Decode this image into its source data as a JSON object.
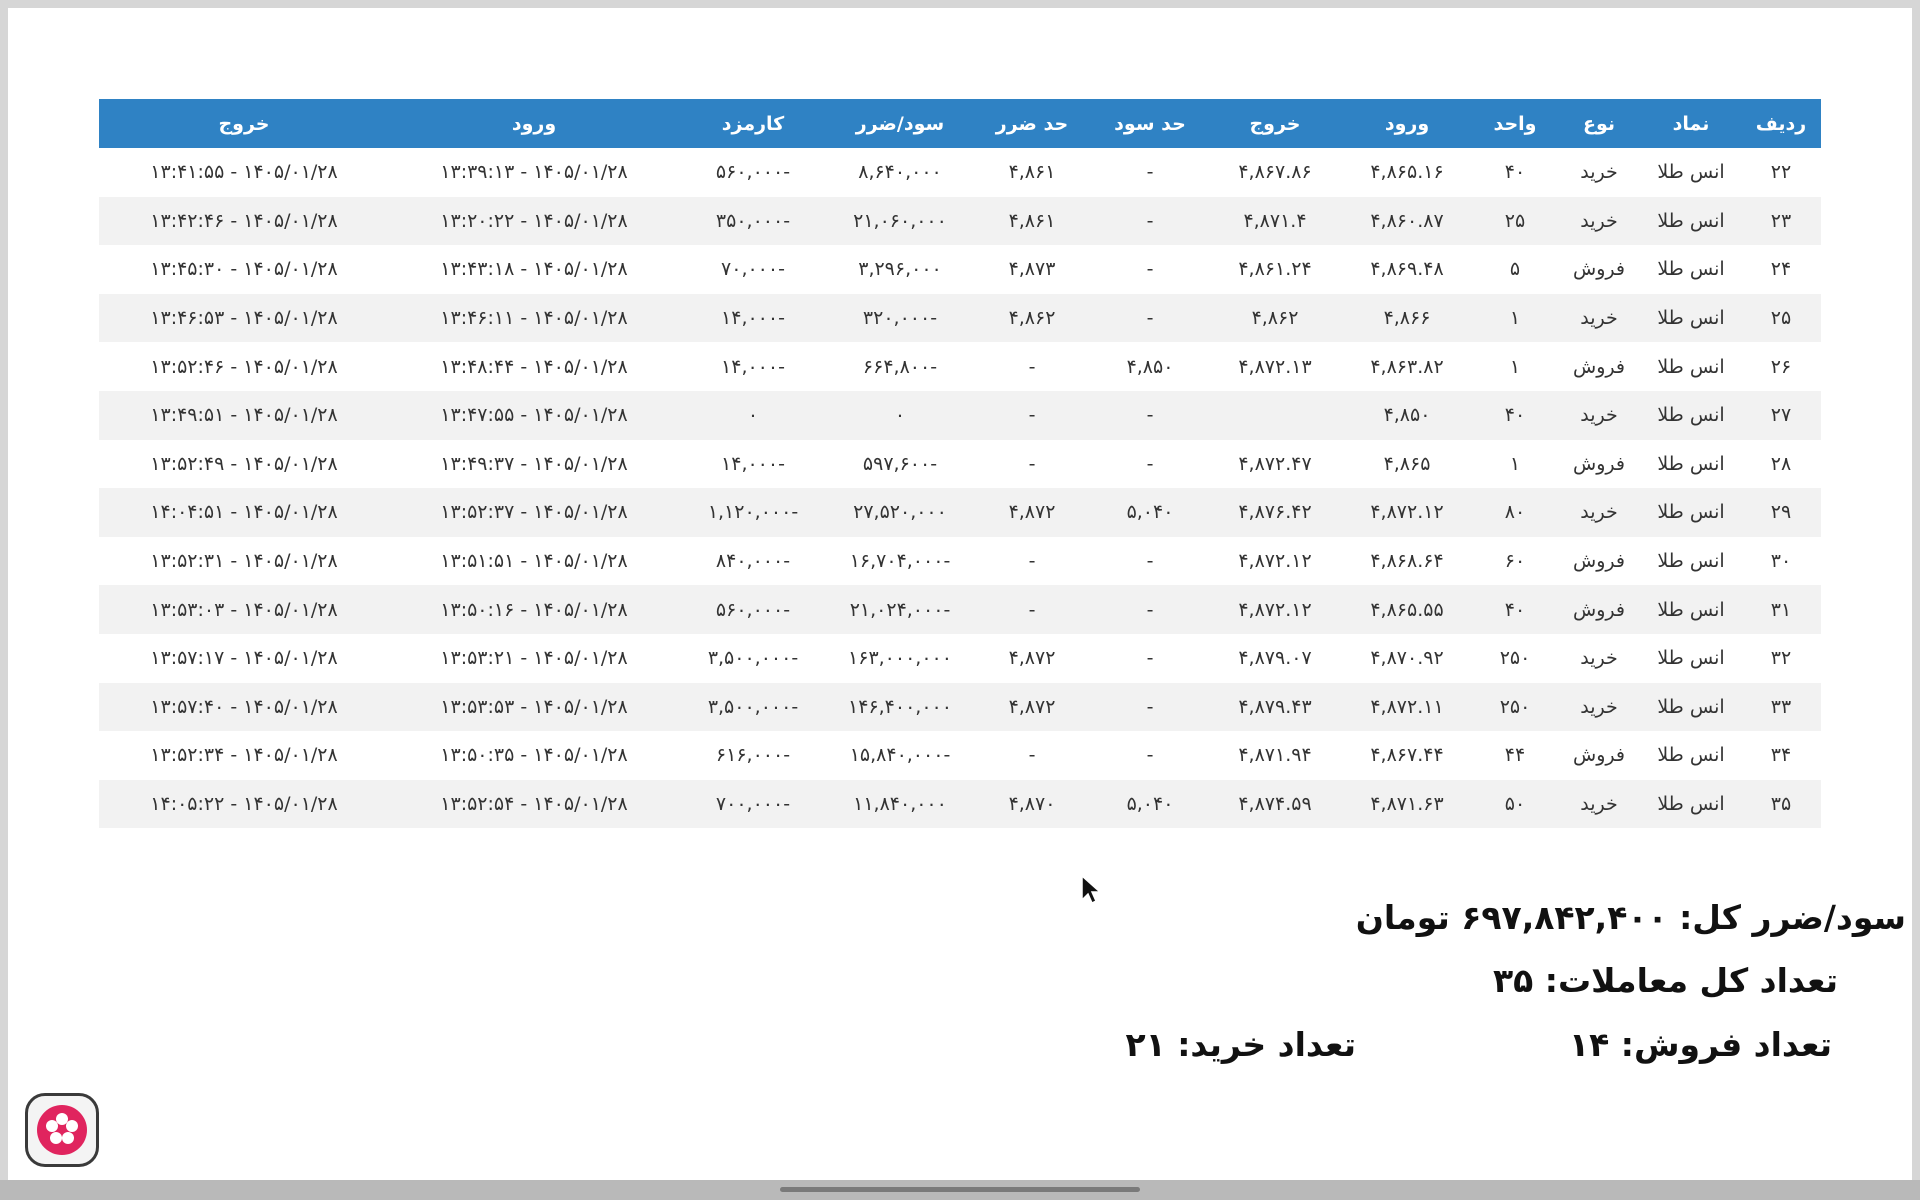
{
  "table": {
    "headers": [
      "ردیف",
      "نماد",
      "نوع",
      "واحد",
      "ورود",
      "خروج",
      "حد سود",
      "حد ضرر",
      "سود/ضرر",
      "کارمزد",
      "ورود",
      "خروج"
    ],
    "rows": [
      [
        "۲۲",
        "انس طلا",
        "خرید",
        "۴۰",
        "۴,۸۶۵.۱۶",
        "۴,۸۶۷.۸۶",
        "-",
        "۴,۸۶۱",
        "۸,۶۴۰,۰۰۰",
        "-۵۶۰,۰۰۰",
        "۱۴۰۵/۰۱/۲۸ - ۱۳:۳۹:۱۳",
        "۱۴۰۵/۰۱/۲۸ - ۱۳:۴۱:۵۵"
      ],
      [
        "۲۳",
        "انس طلا",
        "خرید",
        "۲۵",
        "۴,۸۶۰.۸۷",
        "۴,۸۷۱.۴",
        "-",
        "۴,۸۶۱",
        "۲۱,۰۶۰,۰۰۰",
        "-۳۵۰,۰۰۰",
        "۱۴۰۵/۰۱/۲۸ - ۱۳:۲۰:۲۲",
        "۱۴۰۵/۰۱/۲۸ - ۱۳:۴۲:۴۶"
      ],
      [
        "۲۴",
        "انس طلا",
        "فروش",
        "۵",
        "۴,۸۶۹.۴۸",
        "۴,۸۶۱.۲۴",
        "-",
        "۴,۸۷۳",
        "۳,۲۹۶,۰۰۰",
        "-۷۰,۰۰۰",
        "۱۴۰۵/۰۱/۲۸ - ۱۳:۴۳:۱۸",
        "۱۴۰۵/۰۱/۲۸ - ۱۳:۴۵:۳۰"
      ],
      [
        "۲۵",
        "انس طلا",
        "خرید",
        "۱",
        "۴,۸۶۶",
        "۴,۸۶۲",
        "-",
        "۴,۸۶۲",
        "-۳۲۰,۰۰۰",
        "-۱۴,۰۰۰",
        "۱۴۰۵/۰۱/۲۸ - ۱۳:۴۶:۱۱",
        "۱۴۰۵/۰۱/۲۸ - ۱۳:۴۶:۵۳"
      ],
      [
        "۲۶",
        "انس طلا",
        "فروش",
        "۱",
        "۴,۸۶۳.۸۲",
        "۴,۸۷۲.۱۳",
        "۴,۸۵۰",
        "-",
        "-۶۶۴,۸۰۰",
        "-۱۴,۰۰۰",
        "۱۴۰۵/۰۱/۲۸ - ۱۳:۴۸:۴۴",
        "۱۴۰۵/۰۱/۲۸ - ۱۳:۵۲:۴۶"
      ],
      [
        "۲۷",
        "انس طلا",
        "خرید",
        "۴۰",
        "۴,۸۵۰",
        "",
        "-",
        "-",
        "۰",
        "۰",
        "۱۴۰۵/۰۱/۲۸ - ۱۳:۴۷:۵۵",
        "۱۴۰۵/۰۱/۲۸ - ۱۳:۴۹:۵۱"
      ],
      [
        "۲۸",
        "انس طلا",
        "فروش",
        "۱",
        "۴,۸۶۵",
        "۴,۸۷۲.۴۷",
        "-",
        "-",
        "-۵۹۷,۶۰۰",
        "-۱۴,۰۰۰",
        "۱۴۰۵/۰۱/۲۸ - ۱۳:۴۹:۳۷",
        "۱۴۰۵/۰۱/۲۸ - ۱۳:۵۲:۴۹"
      ],
      [
        "۲۹",
        "انس طلا",
        "خرید",
        "۸۰",
        "۴,۸۷۲.۱۲",
        "۴,۸۷۶.۴۲",
        "۵,۰۴۰",
        "۴,۸۷۲",
        "۲۷,۵۲۰,۰۰۰",
        "-۱,۱۲۰,۰۰۰",
        "۱۴۰۵/۰۱/۲۸ - ۱۳:۵۲:۳۷",
        "۱۴۰۵/۰۱/۲۸ - ۱۴:۰۴:۵۱"
      ],
      [
        "۳۰",
        "انس طلا",
        "فروش",
        "۶۰",
        "۴,۸۶۸.۶۴",
        "۴,۸۷۲.۱۲",
        "-",
        "-",
        "-۱۶,۷۰۴,۰۰۰",
        "-۸۴۰,۰۰۰",
        "۱۴۰۵/۰۱/۲۸ - ۱۳:۵۱:۵۱",
        "۱۴۰۵/۰۱/۲۸ - ۱۳:۵۲:۳۱"
      ],
      [
        "۳۱",
        "انس طلا",
        "فروش",
        "۴۰",
        "۴,۸۶۵.۵۵",
        "۴,۸۷۲.۱۲",
        "-",
        "-",
        "-۲۱,۰۲۴,۰۰۰",
        "-۵۶۰,۰۰۰",
        "۱۴۰۵/۰۱/۲۸ - ۱۳:۵۰:۱۶",
        "۱۴۰۵/۰۱/۲۸ - ۱۳:۵۳:۰۳"
      ],
      [
        "۳۲",
        "انس طلا",
        "خرید",
        "۲۵۰",
        "۴,۸۷۰.۹۲",
        "۴,۸۷۹.۰۷",
        "-",
        "۴,۸۷۲",
        "۱۶۳,۰۰۰,۰۰۰",
        "-۳,۵۰۰,۰۰۰",
        "۱۴۰۵/۰۱/۲۸ - ۱۳:۵۳:۲۱",
        "۱۴۰۵/۰۱/۲۸ - ۱۳:۵۷:۱۷"
      ],
      [
        "۳۳",
        "انس طلا",
        "خرید",
        "۲۵۰",
        "۴,۸۷۲.۱۱",
        "۴,۸۷۹.۴۳",
        "-",
        "۴,۸۷۲",
        "۱۴۶,۴۰۰,۰۰۰",
        "-۳,۵۰۰,۰۰۰",
        "۱۴۰۵/۰۱/۲۸ - ۱۳:۵۳:۵۳",
        "۱۴۰۵/۰۱/۲۸ - ۱۳:۵۷:۴۰"
      ],
      [
        "۳۴",
        "انس طلا",
        "فروش",
        "۴۴",
        "۴,۸۶۷.۴۴",
        "۴,۸۷۱.۹۴",
        "-",
        "-",
        "-۱۵,۸۴۰,۰۰۰",
        "-۶۱۶,۰۰۰",
        "۱۴۰۵/۰۱/۲۸ - ۱۳:۵۰:۳۵",
        "۱۴۰۵/۰۱/۲۸ - ۱۳:۵۲:۳۴"
      ],
      [
        "۳۵",
        "انس طلا",
        "خرید",
        "۵۰",
        "۴,۸۷۱.۶۳",
        "۴,۸۷۴.۵۹",
        "۵,۰۴۰",
        "۴,۸۷۰",
        "۱۱,۸۴۰,۰۰۰",
        "-۷۰۰,۰۰۰",
        "۱۴۰۵/۰۱/۲۸ - ۱۳:۵۲:۵۴",
        "۱۴۰۵/۰۱/۲۸ - ۱۴:۰۵:۲۲"
      ]
    ]
  },
  "summary": {
    "total_pl": "سود/ضرر کل: ۶۹۷,۸۴۲,۴۰۰ تومان",
    "total_trades": "تعداد کل معاملات: ۳۵",
    "sell_count": "تعداد فروش: ۱۴",
    "buy_count": "تعداد خرید: ۲۱"
  },
  "colors": {
    "header_bg": "#2f82c4",
    "row_alt": "#f2f2f2",
    "launcher_accent": "#e0245e"
  },
  "icons": {
    "cursor": "mouse-cursor-icon",
    "launcher": "app-launcher-icon"
  }
}
